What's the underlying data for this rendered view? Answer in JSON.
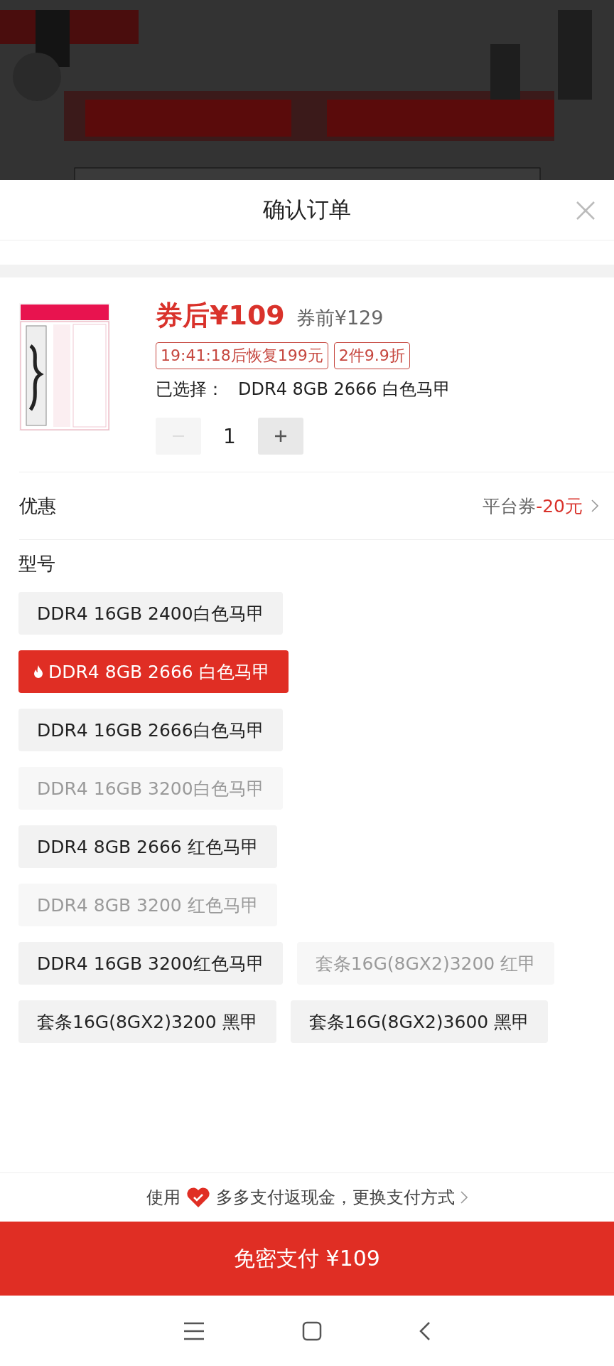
{
  "sheet": {
    "title": "确认订单"
  },
  "product": {
    "price_after": "券后¥109",
    "price_before": "券前¥129",
    "tags": [
      "19:41:18后恢复199元",
      "2件9.9折"
    ],
    "selected_label": "已选择：",
    "selected_value": "DDR4 8GB 2666 白色马甲",
    "quantity": "1",
    "decrease_disabled": true
  },
  "discount": {
    "label": "优惠",
    "prefix": "平台券",
    "amount": "-20元"
  },
  "models": {
    "title": "型号",
    "option_rows": [
      [
        {
          "label": "DDR4 16GB 2400白色马甲",
          "selected": false,
          "disabled": false
        }
      ],
      [
        {
          "label": "DDR4 8GB 2666 白色马甲",
          "selected": true,
          "disabled": false
        }
      ],
      [
        {
          "label": "DDR4 16GB 2666白色马甲",
          "selected": false,
          "disabled": false
        }
      ],
      [
        {
          "label": "DDR4 16GB 3200白色马甲",
          "selected": false,
          "disabled": true
        }
      ],
      [
        {
          "label": "DDR4 8GB 2666 红色马甲",
          "selected": false,
          "disabled": false
        }
      ],
      [
        {
          "label": "DDR4 8GB 3200 红色马甲",
          "selected": false,
          "disabled": true
        }
      ],
      [
        {
          "label": "DDR4 16GB 3200红色马甲",
          "selected": false,
          "disabled": false
        },
        {
          "label": "套条16G(8GX2)3200 红甲",
          "selected": false,
          "disabled": true
        }
      ],
      [
        {
          "label": "套条16G(8GX2)3200 黑甲",
          "selected": false,
          "disabled": false
        },
        {
          "label": "套条16G(8GX2)3600 黑甲",
          "selected": false,
          "disabled": false
        }
      ]
    ]
  },
  "payment": {
    "hint_before": "使用",
    "hint_after": "多多支付返现金，更换支付方式",
    "pay_button": "免密支付 ¥109"
  }
}
